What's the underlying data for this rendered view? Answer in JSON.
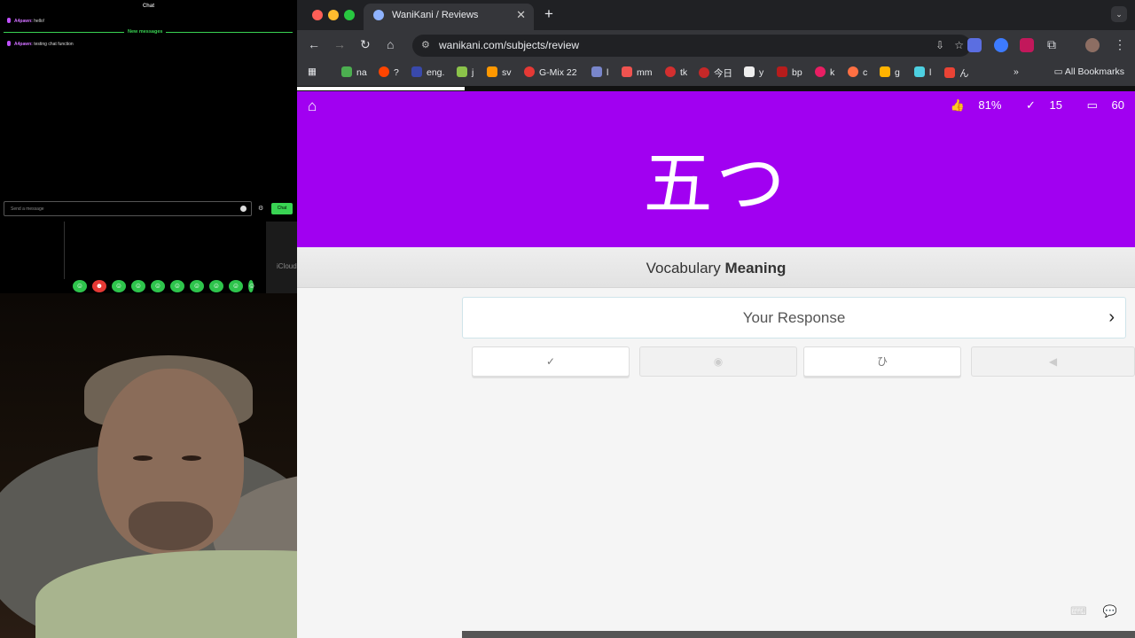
{
  "chat": {
    "title": "Chat",
    "new_messages": "New messages",
    "messages": [
      {
        "user": "A4pawn:",
        "text": "hello!"
      },
      {
        "user": "A4pawn:",
        "text": "testing chat function"
      }
    ],
    "input_placeholder": "Send a message",
    "send_label": "Chat",
    "side_label": "iCloud"
  },
  "browser": {
    "tab_title": "WaniKani / Reviews",
    "url": "wanikani.com/subjects/review",
    "bookmarks": [
      "na",
      "?",
      "eng.",
      "j",
      "sv",
      "G-Mix 22",
      "l",
      "mm",
      "tk",
      "今日",
      "y",
      "bp",
      "k",
      "c",
      "g",
      "l",
      "ん"
    ],
    "all_bookmarks": "All Bookmarks",
    "colors": {
      "tab_bar": "#202124",
      "toolbar": "#35363a",
      "hero": "#a100f1"
    }
  },
  "review": {
    "progress_fraction": 0.2,
    "stats": {
      "percent": "81%",
      "done": "15",
      "remaining": "60"
    },
    "subject": "五つ",
    "question_type_prefix": "Vocabulary",
    "question_type": "Meaning",
    "response_placeholder": "Your Response",
    "action_buttons": [
      {
        "icon": "check-icon",
        "glyph": "✓"
      },
      {
        "icon": "eye-icon",
        "glyph": "👁"
      },
      {
        "icon": "kana-icon",
        "glyph": "ひ"
      },
      {
        "icon": "audio-icon",
        "glyph": "◀"
      }
    ]
  }
}
